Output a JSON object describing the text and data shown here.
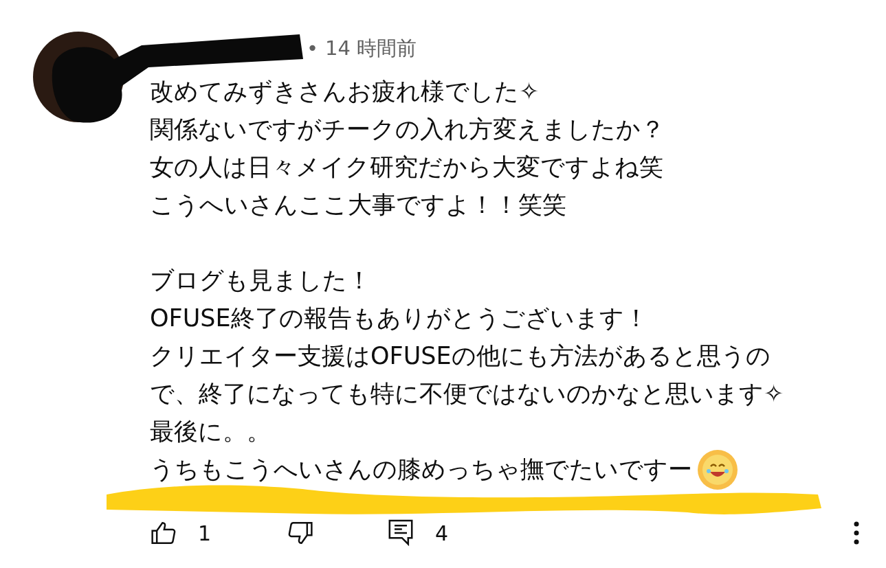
{
  "comment": {
    "separator": "•",
    "time": "14 時間前",
    "paragraphs": [
      [
        "改めてみずきさんお疲れ様でした✧",
        "関係ないですがチークの入れ方変えましたか？",
        "女の人は日々メイク研究だから大変ですよね笑",
        "こうへいさんここ大事ですよ！！笑笑"
      ],
      [
        "ブログも見ました！",
        "OFUSE終了の報告もありがとうございます！",
        "クリエイター支援はOFUSEの他にも方法があると思うの",
        "で、終了になっても特に不便ではないのかなと思います✧",
        "最後に。。",
        "うちもこうへいさんの膝めっちゃ撫でたいですー"
      ]
    ]
  },
  "actions": {
    "likes": "1",
    "replies": "4"
  }
}
